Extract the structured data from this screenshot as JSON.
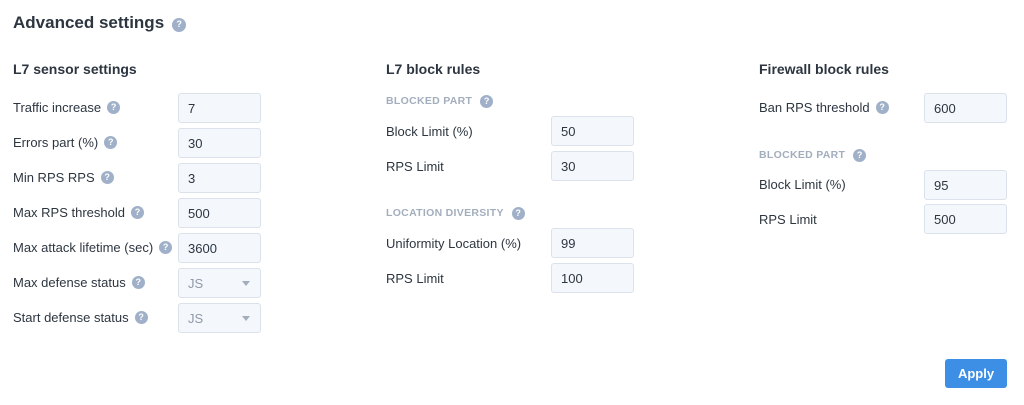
{
  "page": {
    "title": "Advanced settings"
  },
  "l7_sensor": {
    "title": "L7 sensor settings",
    "traffic_increase": {
      "label": "Traffic increase",
      "value": "7"
    },
    "errors_part": {
      "label": "Errors part (%)",
      "value": "30"
    },
    "min_rps": {
      "label": "Min RPS RPS",
      "value": "3"
    },
    "max_rps_threshold": {
      "label": "Max RPS threshold",
      "value": "500"
    },
    "max_attack_lifetime": {
      "label": "Max attack lifetime (sec)",
      "value": "3600"
    },
    "max_defense_status": {
      "label": "Max defense status",
      "value": "JS"
    },
    "start_defense_status": {
      "label": "Start defense status",
      "value": "JS"
    }
  },
  "l7_block": {
    "title": "L7 block rules",
    "blocked_part": {
      "heading": "BLOCKED PART",
      "block_limit": {
        "label": "Block Limit (%)",
        "value": "50"
      },
      "rps_limit": {
        "label": "RPS Limit",
        "value": "30"
      }
    },
    "location_diversity": {
      "heading": "LOCATION DIVERSITY",
      "uniformity": {
        "label": "Uniformity Location (%)",
        "value": "99"
      },
      "rps_limit": {
        "label": "RPS Limit",
        "value": "100"
      }
    }
  },
  "firewall": {
    "title": "Firewall block rules",
    "ban_rps_threshold": {
      "label": "Ban RPS threshold",
      "value": "600"
    },
    "blocked_part": {
      "heading": "BLOCKED PART",
      "block_limit": {
        "label": "Block Limit (%)",
        "value": "95"
      },
      "rps_limit": {
        "label": "RPS Limit",
        "value": "500"
      }
    }
  },
  "help_glyph": "?",
  "apply_label": "Apply",
  "colors": {
    "accent": "#3d8fe6",
    "help": "#9fb0c8",
    "field_bg": "#f4f7fc"
  }
}
